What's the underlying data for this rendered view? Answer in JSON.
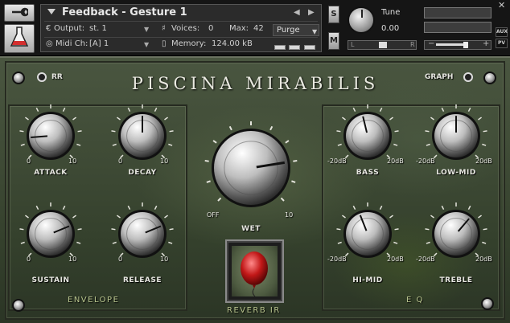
{
  "header": {
    "instrument_title": "Feedback - Gesture 1",
    "output_label": "Output:",
    "output_value": "st. 1",
    "voices_label": "Voices:",
    "voices_value": "0",
    "max_label": "Max:",
    "max_value": "42",
    "purge_label": "Purge",
    "midi_label": "Midi Ch:",
    "midi_value": "[A] 1",
    "memory_label": "Memory:",
    "memory_value": "124.00 kB",
    "solo_label": "S",
    "mute_label": "M",
    "tune_label": "Tune",
    "tune_value": "0.00",
    "pan_left": "L",
    "pan_right": "R",
    "aux_label": "AUX",
    "pv_label": "PV",
    "vol_minus": "−",
    "vol_plus": "+"
  },
  "panel": {
    "title": "PISCINA MIRABILIS",
    "rr_label": "RR",
    "graph_label": "GRAPH",
    "envelope_label": "ENVELOPE",
    "eq_label": "E Q",
    "reverb_ir_label": "REVERB IR",
    "knobs": {
      "attack": {
        "label": "ATTACK",
        "min": "0",
        "max": "10",
        "value": 0.15
      },
      "decay": {
        "label": "DECAY",
        "min": "0",
        "max": "10",
        "value": 0.5
      },
      "sustain": {
        "label": "SUSTAIN",
        "min": "0",
        "max": "10",
        "value": 0.75
      },
      "release": {
        "label": "RELEASE",
        "min": "0",
        "max": "10",
        "value": 0.75
      },
      "wet": {
        "label": "WET",
        "min": "OFF",
        "max": "10",
        "value": 0.8
      },
      "bass": {
        "label": "BASS",
        "min": "-20dB",
        "max": "20dB",
        "value": 0.45
      },
      "low_mid": {
        "label": "LOW-MID",
        "min": "-20dB",
        "max": "20dB",
        "value": 0.5
      },
      "hi_mid": {
        "label": "HI-MID",
        "min": "-20dB",
        "max": "20dB",
        "value": 0.42
      },
      "treble": {
        "label": "TREBLE",
        "min": "-20dB",
        "max": "20dB",
        "value": 0.65
      }
    }
  }
}
